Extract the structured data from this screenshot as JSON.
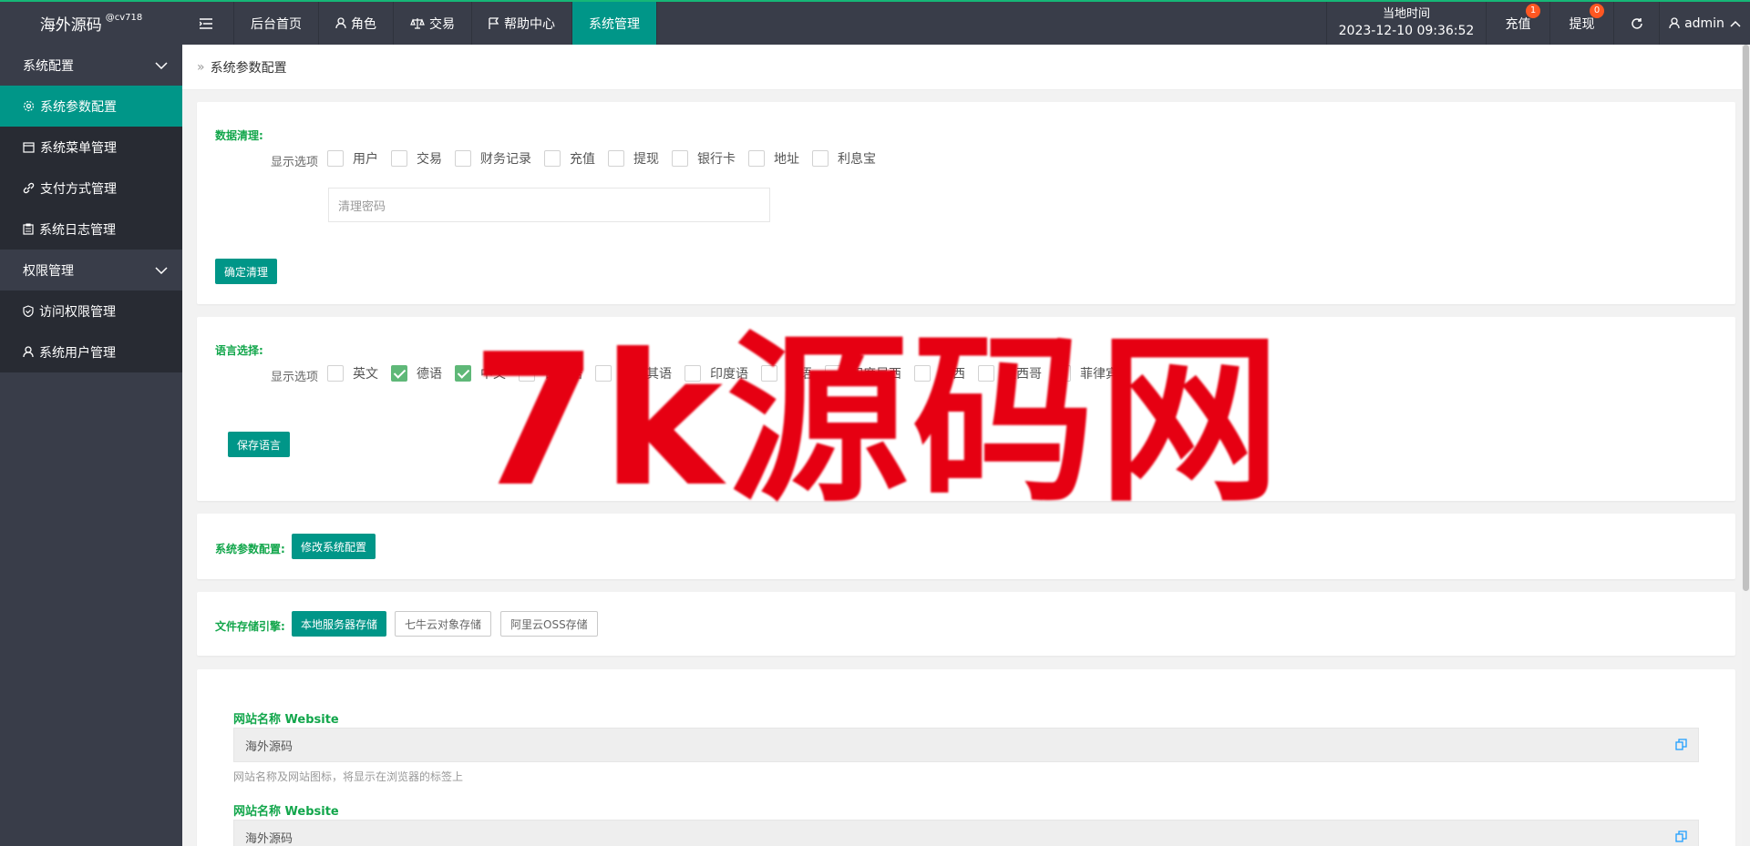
{
  "topbar": {
    "logo_text": "海外源码",
    "logo_sup": "@cv718",
    "nav": [
      "后台首页",
      "角色",
      "交易",
      "帮助中心",
      "系统管理"
    ],
    "clock_label": "当地时间",
    "clock_value": "2023-12-10 09:36:52",
    "recharge_label": "充值",
    "recharge_badge": "1",
    "withdraw_label": "提现",
    "withdraw_badge": "0",
    "user": "admin"
  },
  "sidebar": {
    "group1": "系统配置",
    "items1": [
      "系统参数配置",
      "系统菜单管理",
      "支付方式管理",
      "系统日志管理"
    ],
    "group2": "权限管理",
    "items2": [
      "访问权限管理",
      "系统用户管理"
    ]
  },
  "breadcrumb": "系统参数配置",
  "data_clean": {
    "title": "数据清理:",
    "row_label": "显示选项",
    "options": [
      "用户",
      "交易",
      "财务记录",
      "充值",
      "提现",
      "银行卡",
      "地址",
      "利息宝"
    ],
    "password_placeholder": "清理密码",
    "button": "确定清理"
  },
  "language": {
    "title": "语言选择:",
    "row_label": "显示选项",
    "options": [
      "英文",
      "德语",
      "中文",
      "日本語",
      "土耳其语",
      "印度语",
      "韩语",
      "印度尼西",
      "巴西",
      "墨西哥",
      "菲律宾"
    ],
    "checked": [
      false,
      true,
      true,
      false,
      false,
      false,
      false,
      false,
      false,
      false,
      false
    ],
    "button": "保存语言"
  },
  "sys_param": {
    "title": "系统参数配置:",
    "button": "修改系统配置"
  },
  "storage": {
    "title": "文件存储引擎:",
    "buttons": [
      "本地服务器存储",
      "七牛云对象存储",
      "阿里云OSS存储"
    ]
  },
  "website": {
    "label1": "网站名称 Website",
    "value1": "海外源码",
    "hint1": "网站名称及网站图标，将显示在浏览器的标签上",
    "label2": "网站名称 Website",
    "value2": "海外源码"
  },
  "watermark": "7k源码网",
  "colors": {
    "accent": "#009688",
    "topbar": "#393d49",
    "badge": "#ff5722",
    "section_title": "#12a64b",
    "watermark": "#e60012"
  }
}
